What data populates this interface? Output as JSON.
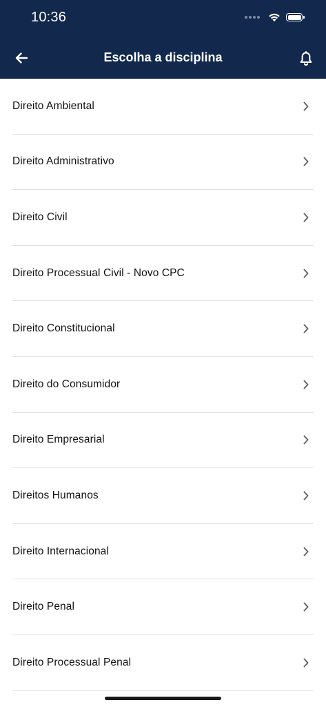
{
  "status_bar": {
    "time": "10:36"
  },
  "header": {
    "title": "Escolha a disciplina",
    "background": "#12284c"
  },
  "list": {
    "items": [
      {
        "label": "Direito Ambiental"
      },
      {
        "label": "Direito Administrativo"
      },
      {
        "label": "Direito Civil"
      },
      {
        "label": "Direito Processual Civil - Novo CPC"
      },
      {
        "label": "Direito Constitucional"
      },
      {
        "label": "Direito do Consumidor"
      },
      {
        "label": "Direito Empresarial"
      },
      {
        "label": "Direitos Humanos"
      },
      {
        "label": "Direito Internacional"
      },
      {
        "label": "Direito Penal"
      },
      {
        "label": "Direito Processual Penal"
      }
    ]
  },
  "icons": {
    "back": "arrow-left-icon",
    "notifications": "bell-icon",
    "row": "chevron-right-icon"
  }
}
